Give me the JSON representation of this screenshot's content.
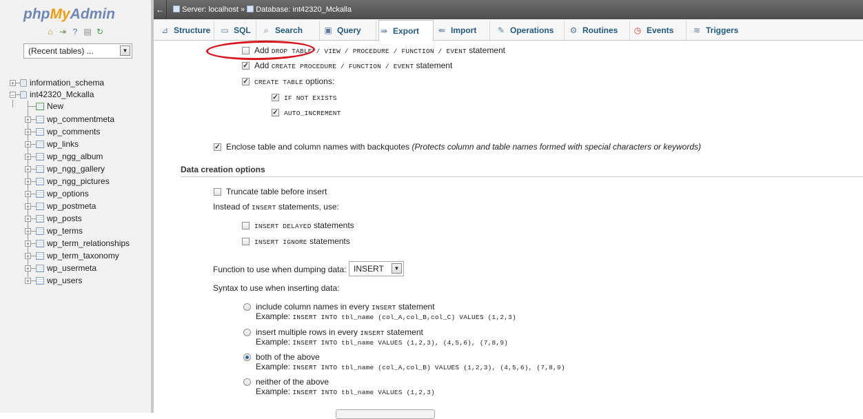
{
  "app": {
    "logo_php": "php",
    "logo_my": "My",
    "logo_admin": "Admin"
  },
  "sidebar": {
    "recent_tables": "(Recent tables) ...",
    "quick_icons": [
      "home-icon",
      "logout-icon",
      "help-icon",
      "docs-icon",
      "reload-icon"
    ],
    "databases": [
      {
        "name": "information_schema",
        "expanded": false
      },
      {
        "name": "int42320_Mckalla",
        "expanded": true
      }
    ],
    "new_label": "New",
    "tables": [
      "wp_commentmeta",
      "wp_comments",
      "wp_links",
      "wp_ngg_album",
      "wp_ngg_gallery",
      "wp_ngg_pictures",
      "wp_options",
      "wp_postmeta",
      "wp_posts",
      "wp_terms",
      "wp_term_relationships",
      "wp_term_taxonomy",
      "wp_usermeta",
      "wp_users"
    ]
  },
  "breadcrumb": {
    "server": "Server: localhost",
    "sep": "»",
    "database": "Database: int42320_Mckalla"
  },
  "tabs": [
    {
      "label": "Structure",
      "icon": "structure-icon"
    },
    {
      "label": "SQL",
      "icon": "sql-icon"
    },
    {
      "label": "Search",
      "icon": "search-icon"
    },
    {
      "label": "Query",
      "icon": "query-icon"
    },
    {
      "label": "Export",
      "icon": "export-icon",
      "active": true
    },
    {
      "label": "Import",
      "icon": "import-icon"
    },
    {
      "label": "Operations",
      "icon": "operations-icon"
    },
    {
      "label": "Routines",
      "icon": "routines-icon"
    },
    {
      "label": "Events",
      "icon": "events-icon"
    },
    {
      "label": "Triggers",
      "icon": "triggers-icon"
    }
  ],
  "object_options": {
    "add_drop": {
      "checked": false,
      "pre": "Add",
      "code": "DROP TABLE / VIEW / PROCEDURE / FUNCTION / EVENT",
      "post": "statement"
    },
    "add_create": {
      "checked": true,
      "pre": "Add",
      "code": "CREATE PROCEDURE / FUNCTION / EVENT",
      "post": "statement"
    },
    "create_table": {
      "checked": true,
      "code": "CREATE TABLE",
      "post": "options:"
    },
    "if_not_exists": {
      "checked": true,
      "code": "IF NOT EXISTS"
    },
    "auto_increment": {
      "checked": true,
      "code": "AUTO_INCREMENT"
    },
    "backquotes": {
      "checked": true,
      "label": "Enclose table and column names with backquotes",
      "note": "(Protects column and table names formed with special characters or keywords)"
    }
  },
  "data_creation": {
    "title": "Data creation options",
    "truncate": {
      "checked": false,
      "label": "Truncate table before insert"
    },
    "instead": {
      "pre": "Instead of",
      "code": "INSERT",
      "post": "statements, use:"
    },
    "insert_delayed": {
      "checked": false,
      "code": "INSERT DELAYED",
      "post": "statements"
    },
    "insert_ignore": {
      "checked": false,
      "code": "INSERT IGNORE",
      "post": "statements"
    },
    "function_label": "Function to use when dumping data:",
    "function_value": "INSERT",
    "syntax_label": "Syntax to use when inserting data:",
    "syntax_options": [
      {
        "pre": "include column names in every",
        "code": "INSERT",
        "post": "statement",
        "example_label": "Example:",
        "example": "INSERT INTO tbl_name (col_A,col_B,col_C) VALUES (1,2,3)",
        "selected": false
      },
      {
        "pre": "insert multiple rows in every",
        "code": "INSERT",
        "post": "statement",
        "example_label": "Example:",
        "example": "INSERT INTO tbl_name VALUES (1,2,3), (4,5,6), (7,8,9)",
        "selected": false
      },
      {
        "pre": "both of the above",
        "code": "",
        "post": "",
        "example_label": "Example:",
        "example": "INSERT INTO tbl_name (col_A,col_B) VALUES (1,2,3), (4,5,6), (7,8,9)",
        "selected": true
      },
      {
        "pre": "neither of the above",
        "code": "",
        "post": "",
        "example_label": "Example:",
        "example": "INSERT INTO tbl_name VALUES (1,2,3)",
        "selected": false
      }
    ]
  },
  "colors": {
    "link": "#235a81",
    "annotation": "#d9161e",
    "topbar": "#5c5c5c"
  }
}
